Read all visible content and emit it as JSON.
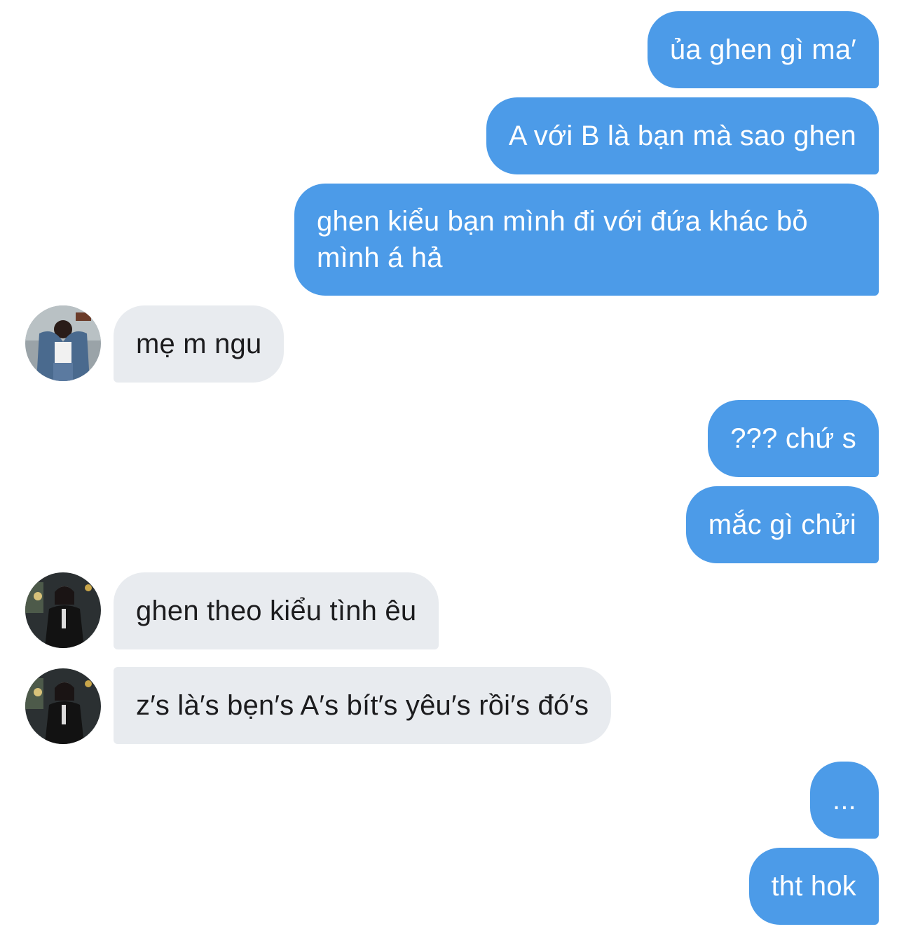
{
  "messages": [
    {
      "side": "out",
      "text": "ủa ghen gì ma′"
    },
    {
      "side": "out",
      "text": "A với B là bạn mà sao ghen"
    },
    {
      "side": "out",
      "lines": [
        "ghen kiểu bạn mình đi với đứa khác bỏ",
        "mình á hả"
      ]
    },
    {
      "side": "in",
      "text": "mẹ m ngu",
      "avatar": "contact-avatar-photo"
    },
    {
      "side": "out",
      "text": "??? chứ s"
    },
    {
      "side": "out",
      "text": "mắc gì chửi"
    },
    {
      "side": "in",
      "text": "ghen theo kiểu tình êu",
      "avatar": "contact-avatar-photo"
    },
    {
      "side": "in",
      "text": "z′s là′s bẹn′s A′s bít′s yêu′s rồi′s đó′s",
      "avatar": "contact-avatar-photo"
    },
    {
      "side": "out",
      "text": "..."
    },
    {
      "side": "out",
      "text": "tht hok"
    }
  ],
  "colors": {
    "outgoing_bubble": "#4c9be8",
    "incoming_bubble": "#e8ebef",
    "background": "#ffffff"
  }
}
